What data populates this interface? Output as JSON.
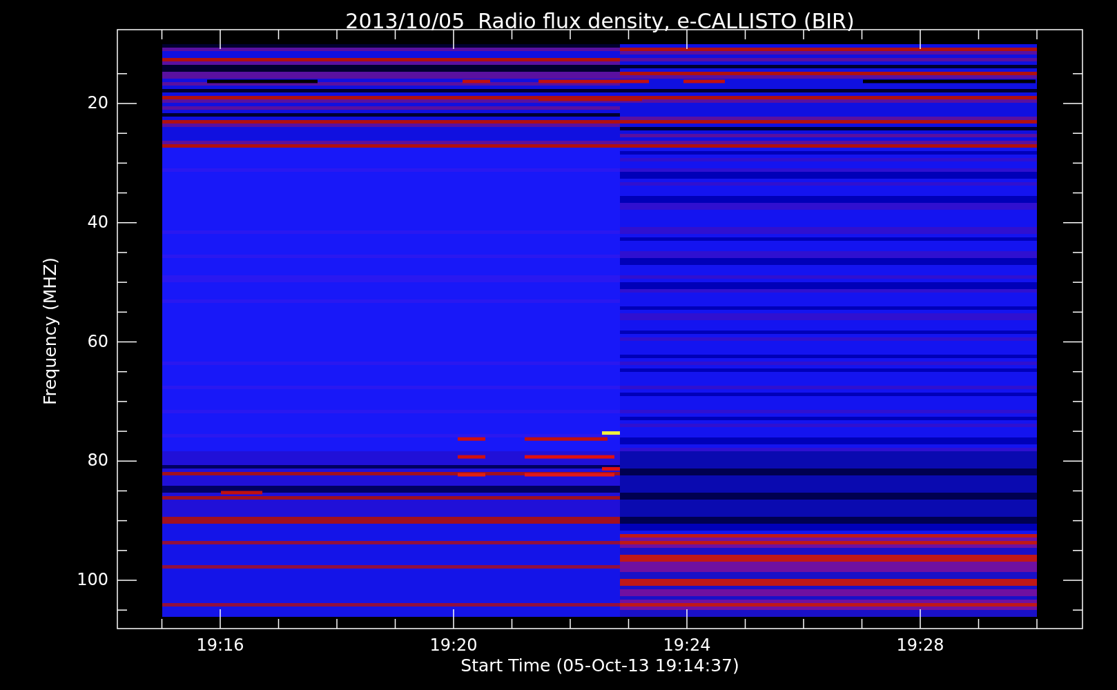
{
  "title": "2013/10/05  Radio flux density, e-CALLISTO (BIR)",
  "y_axis": {
    "label": "Frequency (MHZ)",
    "ticks": [
      "20",
      "40",
      "60",
      "80",
      "100"
    ]
  },
  "x_axis": {
    "label": "Start Time (05-Oct-13 19:14:37)",
    "ticks": [
      "19:16",
      "19:20",
      "19:24",
      "19:28"
    ]
  }
}
